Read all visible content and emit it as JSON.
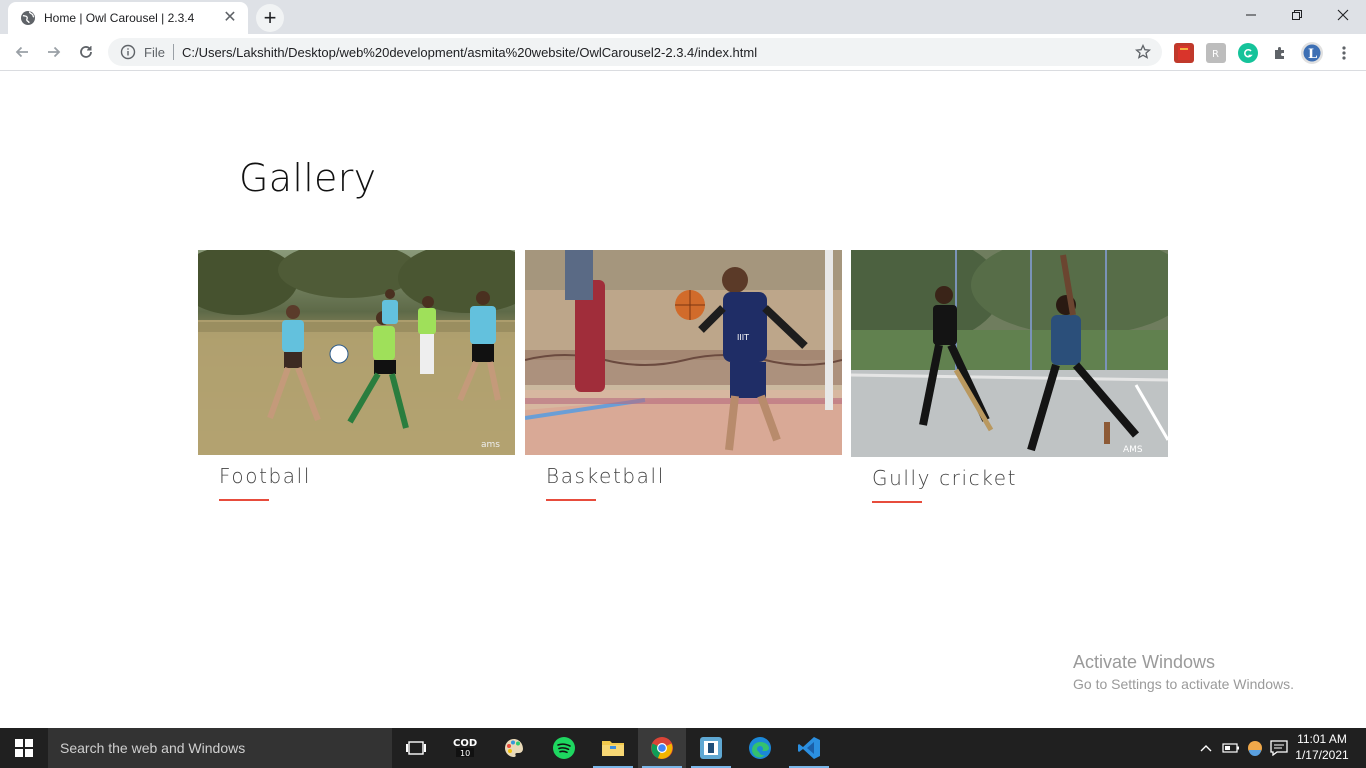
{
  "browser": {
    "tab_title": "Home | Owl Carousel | 2.3.4",
    "tab_close": "✕",
    "new_tab": "+",
    "scheme_label": "File",
    "url": "C:/Users/Lakshith/Desktop/web%20development/asmita%20website/OwlCarousel2-2.3.4/index.html"
  },
  "page": {
    "title": "Gallery",
    "cards": [
      {
        "label": "Football"
      },
      {
        "label": "Basketball"
      },
      {
        "label": "Gully cricket"
      }
    ]
  },
  "watermark": {
    "line1": "Activate Windows",
    "line2": "Go to Settings to activate Windows."
  },
  "taskbar": {
    "search_placeholder": "Search the web and Windows",
    "clock_time": "11:01 AM",
    "clock_date": "1/17/2021"
  }
}
